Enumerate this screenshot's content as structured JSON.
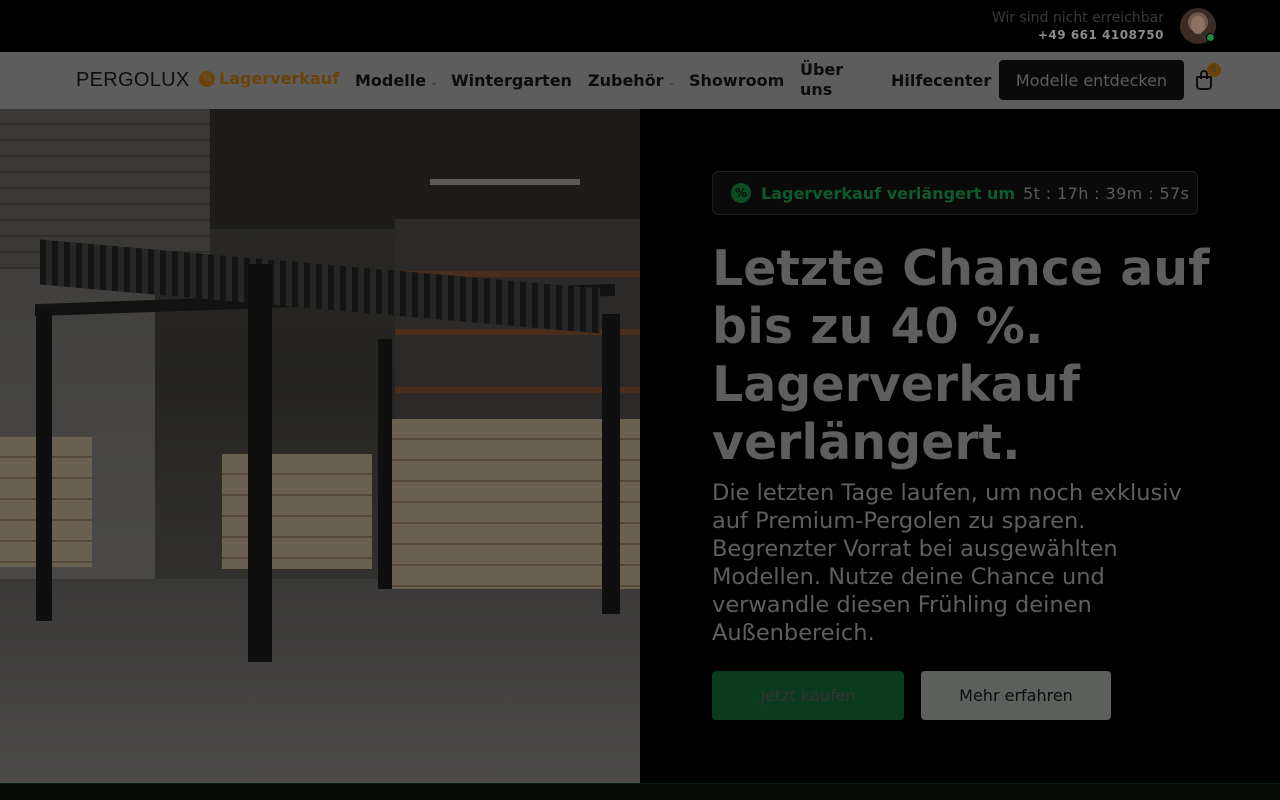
{
  "topbar": {
    "status": "Wir sind nicht erreichbar",
    "phone": "+49 661 4108750"
  },
  "nav": {
    "logo": "PERGOLUX",
    "sale_label": "Lagerverkauf",
    "items": [
      {
        "label": "Modelle",
        "has_dropdown": true
      },
      {
        "label": "Wintergarten",
        "has_dropdown": false
      },
      {
        "label": "Zubehör",
        "has_dropdown": true
      },
      {
        "label": "Showroom",
        "has_dropdown": false
      },
      {
        "label": "Über uns",
        "has_dropdown": false
      },
      {
        "label": "Hilfecenter",
        "has_dropdown": false
      }
    ],
    "cta": "Modelle entdecken",
    "cart_count": "0"
  },
  "hero": {
    "timer_label": "Lagerverkauf verlängert um",
    "timer_value": "5t : 17h : 39m : 57s",
    "headline": "Letzte Chance auf bis zu 40 %. Lagerverkauf verlängert.",
    "subtext": "Die letzten Tage laufen, um noch exklusiv auf Premium-Pergolen zu sparen. Begrenzter Vorrat bei ausgewählten Modellen. Nutze deine Chance und verwandle diesen Frühling deinen Außenbereich.",
    "primary_button": "Jetzt kaufen",
    "secondary_button": "Mehr erfahren"
  },
  "colors": {
    "accent_orange": "#d98a14",
    "accent_green": "#1a9c4b",
    "overlay": "rgba(0,0,0,0.6)"
  }
}
